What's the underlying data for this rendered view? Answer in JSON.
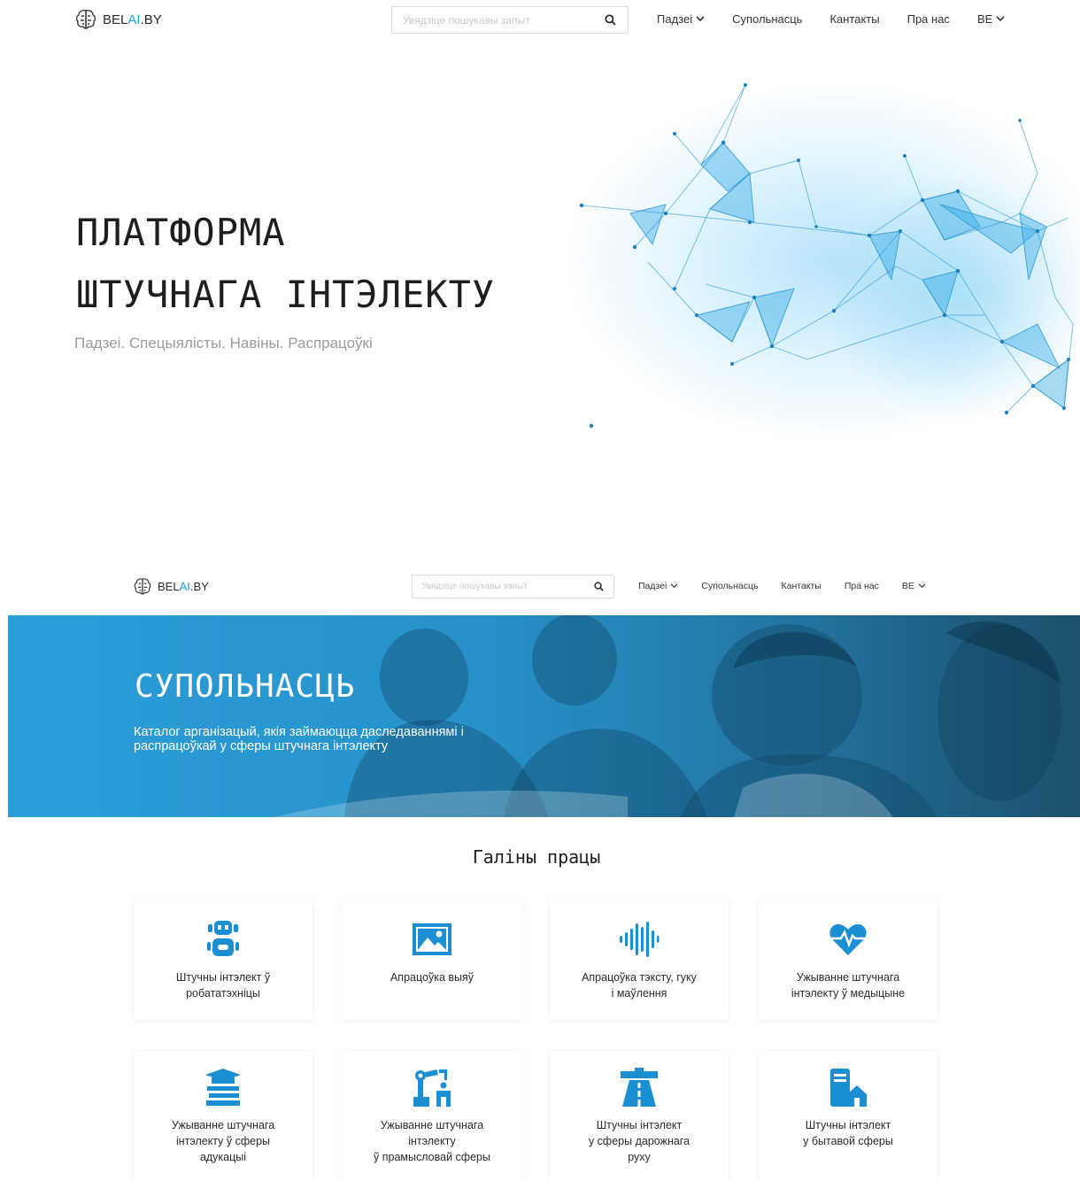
{
  "colors": {
    "accent": "#1ea0dc",
    "icon": "#1b8fd2",
    "banner": "#2a9bd6"
  },
  "header": {
    "logo_parts": [
      "BEL",
      "AI",
      ".BY"
    ],
    "search_placeholder": "Увядзіце пошукавы запыт",
    "nav": {
      "events": "Падзеі",
      "community": "Супольнасць",
      "contacts": "Кантакты",
      "about": "Пра нас",
      "lang": "BE"
    }
  },
  "hero": {
    "title_line1": "ПЛАТФОРМА",
    "title_line2": "ШТУЧНАГА ІНТЭЛЕКТУ",
    "subtitle": "Падзеі. Спецыялісты. Навіны. Распрацоўкі"
  },
  "community": {
    "title": "СУПОЛЬНАСЦЬ",
    "description": "Каталог арганізацый, якія займаюцца даследаваннямі і распрацоўкай у сферы штучнага інтэлекту"
  },
  "fields": {
    "title": "Галіны працы",
    "cards": [
      {
        "label": "Штучны інтэлект ў\nробататэхніцы",
        "icon": "robot-icon"
      },
      {
        "label": "Апрацоўка выяў",
        "icon": "image-icon"
      },
      {
        "label": "Апрацоўка тэксту, гуку\nі маўлення",
        "icon": "soundwave-icon"
      },
      {
        "label": "Ужыванне штучнага\nінтэлекту ў медыцыне",
        "icon": "heartbeat-icon"
      },
      {
        "label": "Ужыванне штучнага\nінтэлекту ў сферы\nадукацыі",
        "icon": "education-icon"
      },
      {
        "label": "Ужыванне штучнага\nінтэлекту\nў прамысловай сферы",
        "icon": "industrial-robot-icon"
      },
      {
        "label": "Штучны інтэлект\nу сферы дарожнага\nруху",
        "icon": "road-icon"
      },
      {
        "label": "Штучны інтэлект\nу бытавой сферы",
        "icon": "smart-home-icon"
      }
    ]
  }
}
